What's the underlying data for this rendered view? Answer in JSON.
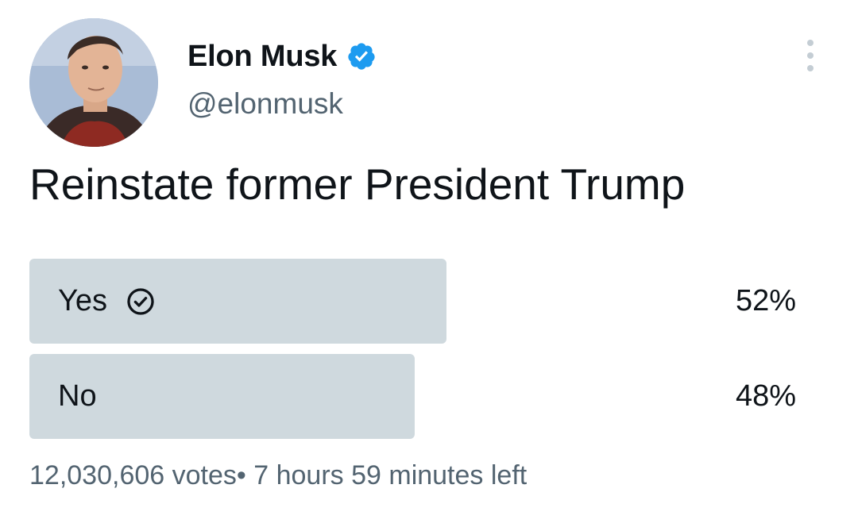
{
  "author": {
    "display_name": "Elon Musk",
    "handle": "@elonmusk",
    "verified": true
  },
  "tweet": {
    "text": "Reinstate former President Trump"
  },
  "poll": {
    "options": [
      {
        "label": "Yes",
        "percent_label": "52%",
        "percent": 52,
        "selected": true
      },
      {
        "label": "No",
        "percent_label": "48%",
        "percent": 48,
        "selected": false
      }
    ],
    "votes_text": "12,030,606 votes",
    "separator": "•",
    "time_left_text": "7 hours 59 minutes left"
  },
  "colors": {
    "bar": "#cfd9de",
    "verified_blue": "#1d9bf0",
    "secondary_text": "#536471",
    "primary_text": "#0f1419"
  },
  "icons": {
    "verified": "verified-badge-icon",
    "selected_option": "check-circle-icon",
    "more": "more-options-icon"
  }
}
